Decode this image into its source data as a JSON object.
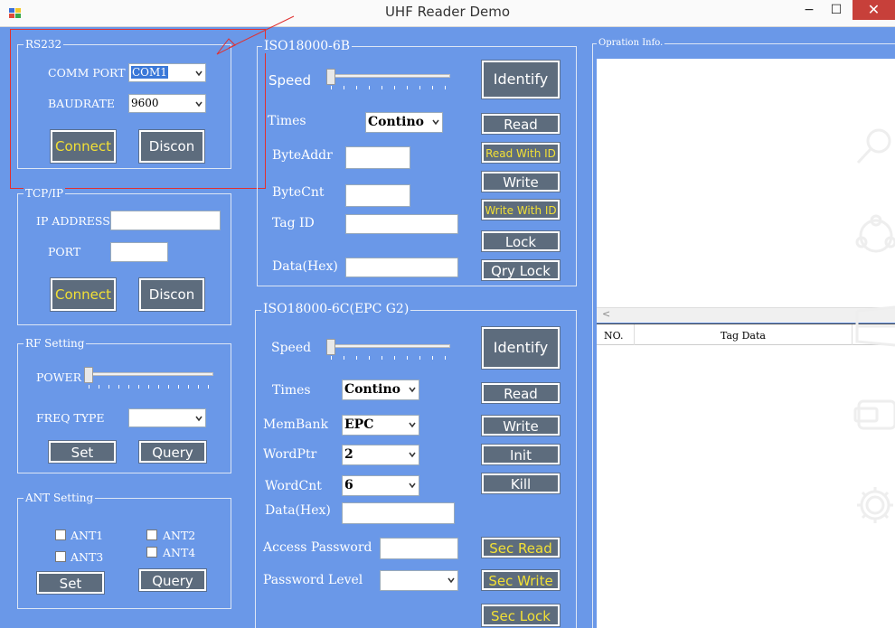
{
  "window": {
    "title": "UHF Reader Demo",
    "minimize": "−",
    "maximize": "☐",
    "close": "✕"
  },
  "rs232": {
    "title": "RS232",
    "comm_port_label": "COMM PORT",
    "comm_port_value": "COM1",
    "baudrate_label": "BAUDRATE",
    "baudrate_value": "9600",
    "connect": "Connect",
    "discon": "Discon"
  },
  "tcpip": {
    "title": "TCP/IP",
    "ip_label": "IP ADDRESS",
    "port_label": "PORT",
    "connect": "Connect",
    "discon": "Discon"
  },
  "rf": {
    "title": "RF Setting",
    "power_label": "POWER",
    "freq_label": "FREQ TYPE",
    "set": "Set",
    "query": "Query"
  },
  "ant": {
    "title": "ANT Setting",
    "ant1": "ANT1",
    "ant2": "ANT2",
    "ant3": "ANT3",
    "ant4": "ANT4",
    "set": "Set",
    "query": "Query"
  },
  "iso6b": {
    "title": "ISO18000-6B",
    "speed": "Speed",
    "times": "Times",
    "times_value": "Contino",
    "byteaddr": "ByteAddr",
    "bytecnt": "ByteCnt",
    "tagid": "Tag ID",
    "data": "Data(Hex)",
    "identify": "Identify",
    "read": "Read",
    "read_with_id": "Read With ID",
    "write": "Write",
    "write_with_id": "Write With ID",
    "lock": "Lock",
    "qry_lock": "Qry Lock"
  },
  "iso6c": {
    "title": "ISO18000-6C(EPC G2)",
    "speed": "Speed",
    "times": "Times",
    "times_value": "Contino",
    "membank": "MemBank",
    "membank_value": "EPC",
    "wordptr": "WordPtr",
    "wordptr_value": "2",
    "wordcnt": "WordCnt",
    "wordcnt_value": "6",
    "data": "Data(Hex)",
    "access_password": "Access Password",
    "password_level": "Password Level",
    "identify": "Identify",
    "read": "Read",
    "write": "Write",
    "init": "Init",
    "kill": "Kill",
    "sec_read": "Sec Read",
    "sec_write": "Sec Write",
    "sec_lock": "Sec Lock"
  },
  "opinfo": {
    "title": "Opration Info.",
    "col_no": "NO.",
    "col_tag": "Tag Data",
    "scroll_left": "<"
  },
  "sidebar_icons": [
    "search-icon",
    "share-icon",
    "start-icon",
    "devices-icon",
    "settings-icon"
  ]
}
